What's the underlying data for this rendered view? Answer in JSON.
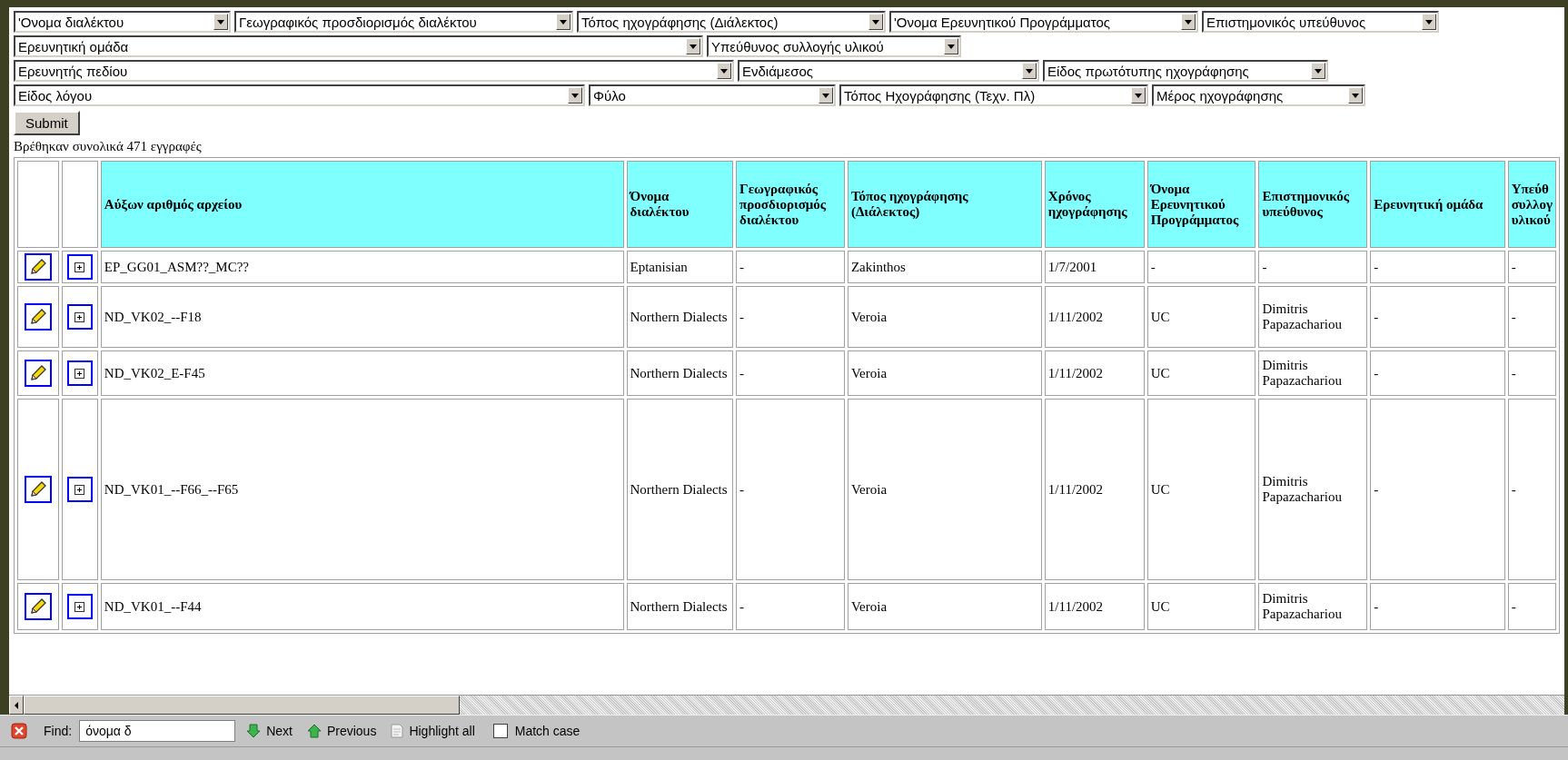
{
  "filters": [
    [
      {
        "label": "'Ονομα διαλέκτου"
      },
      {
        "label": "Γεωγραφικός προσδιορισμός διαλέκτου"
      },
      {
        "label": "Τόπος ηχογράφησης (Διάλεκτος)"
      },
      {
        "label": "'Ονομα Ερευνητικού Προγράμματος"
      },
      {
        "label": "Επιστημονικός υπεύθυνος"
      }
    ],
    [
      {
        "label": "Ερευνητική ομάδα"
      },
      {
        "label": "Υπεύθυνος συλλογής υλικού"
      }
    ],
    [
      {
        "label": "Ερευνητής πεδίου"
      },
      {
        "label": "Ενδιάμεσος"
      },
      {
        "label": "Είδος πρωτότυπης ηχογράφησης"
      }
    ],
    [
      {
        "label": "Είδος λόγου"
      },
      {
        "label": "Φύλο"
      },
      {
        "label": "Τόπος Ηχογράφησης (Τεχν. Πλ)"
      },
      {
        "label": "Μέρος ηχογράφησης"
      }
    ]
  ],
  "submit": "Submit",
  "result_count": "Βρέθηκαν συνολικά 471 εγγραφές",
  "table": {
    "columns": [
      "Αύξων αριθμός αρχείου",
      "Όνομα διαλέκτου",
      "Γεωγραφικός προσδιορισμός διαλέκτου",
      "Τόπος ηχογράφησης (Διάλεκτος)",
      "Χρόνος ηχογράφησης",
      "Όνομα Ερευνητικού Προγράμματος",
      "Επιστημονικός υπεύθυνος",
      "Ερευνητική ομάδα",
      "Υπεύθ συλλογ υλικού"
    ],
    "rows": [
      [
        "EP_GG01_ASM??_MC??",
        "Eptanisian",
        "-",
        "Zakinthos",
        "1/7/2001",
        "-",
        "-",
        "-",
        "-"
      ],
      [
        "ND_VK02_--F18",
        "Northern Dialects",
        "-",
        "Veroia",
        "1/11/2002",
        "UC",
        "Dimitris Papazachariou",
        "-",
        "-"
      ],
      [
        "ND_VK02_E-F45",
        "Northern Dialects",
        "-",
        "Veroia",
        "1/11/2002",
        "UC",
        "Dimitris Papazachariou",
        "-",
        "-"
      ],
      [
        "ND_VK01_--F66_--F65",
        "Northern Dialects",
        "-",
        "Veroia",
        "1/11/2002",
        "UC",
        "Dimitris Papazachariou",
        "-",
        "-"
      ],
      [
        "ND_VK01_--F44",
        "Northern Dialects",
        "-",
        "Veroia",
        "1/11/2002",
        "UC",
        "Dimitris Papazachariou",
        "-",
        "-"
      ]
    ]
  },
  "find_bar": {
    "label": "Find:",
    "value": "όνομα δ",
    "buttons": [
      {
        "kind": "next",
        "label": "Next"
      },
      {
        "kind": "previous",
        "label": "Previous"
      },
      {
        "kind": "highlight",
        "label": "Highlight all"
      }
    ],
    "match_case": {
      "label": "Match case",
      "checked": false
    }
  }
}
